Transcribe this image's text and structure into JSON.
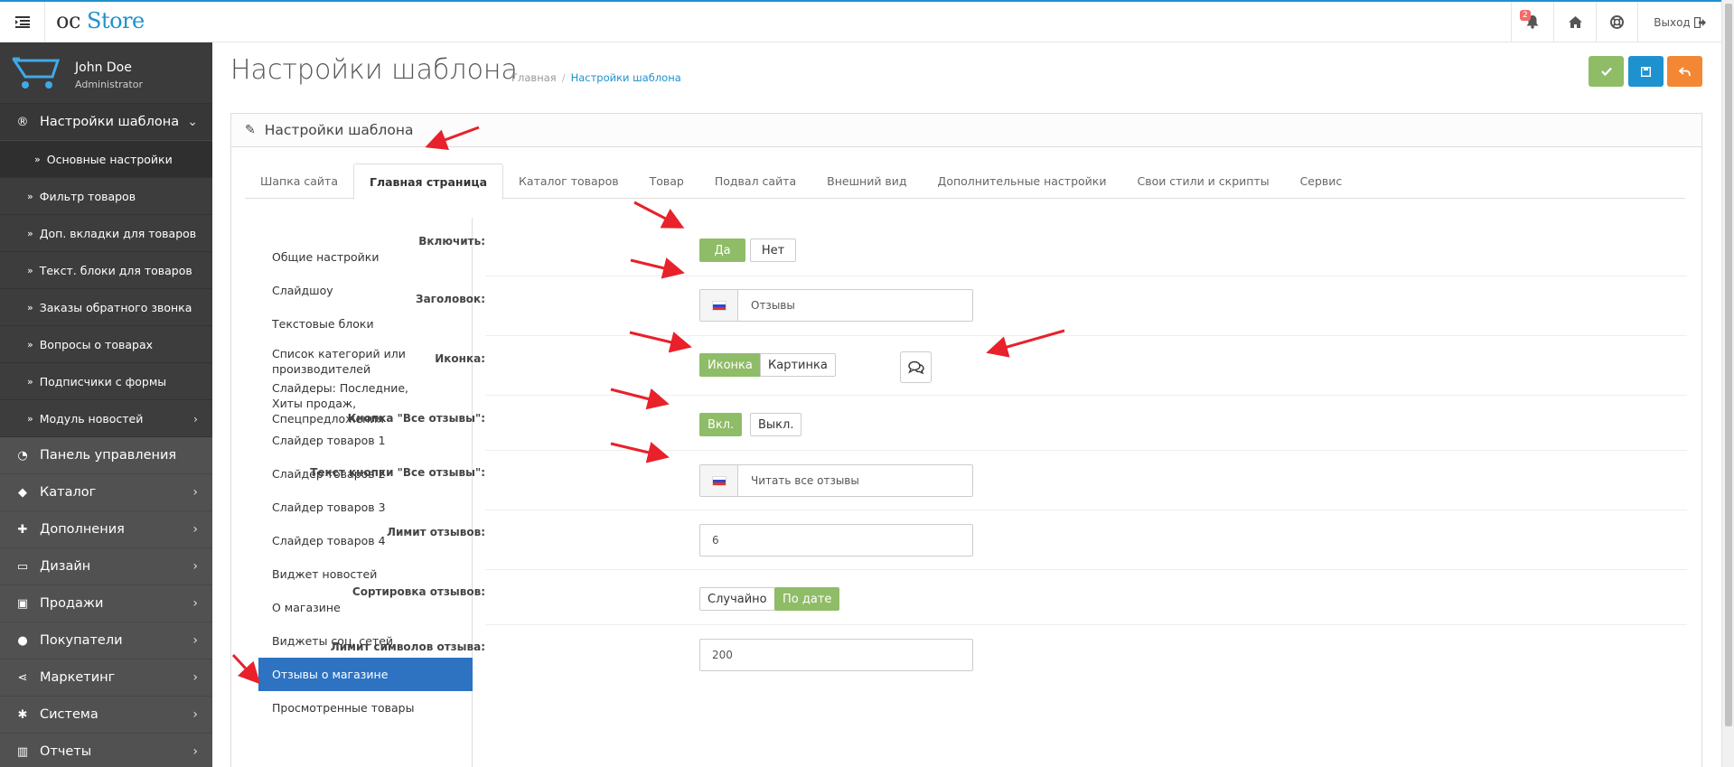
{
  "header": {
    "logo_oc": "oc",
    "logo_store": "Store",
    "notification_count": "2",
    "logout_label": "Выход"
  },
  "sidebar": {
    "user_name": "John Doe",
    "user_role": "Administrator",
    "active_section": "Настройки шаблона",
    "sub_items": [
      "Основные настройки",
      "Фильтр товаров",
      "Доп. вкладки для товаров",
      "Текст. блоки для товаров",
      "Заказы обратного звонка",
      "Вопросы о товарах",
      "Подписчики с формы",
      "Модуль новостей"
    ],
    "menu": [
      "Панель управления",
      "Каталог",
      "Дополнения",
      "Дизайн",
      "Продажи",
      "Покупатели",
      "Маркетинг",
      "Система",
      "Отчеты"
    ]
  },
  "page": {
    "title": "Настройки шаблона",
    "breadcrumb_home": "Главная",
    "breadcrumb_current": "Настройки шаблона",
    "panel_title": "Настройки шаблона"
  },
  "tabs": [
    "Шапка сайта",
    "Главная страница",
    "Каталог товаров",
    "Товар",
    "Подвал сайта",
    "Внешний вид",
    "Дополнительные настройки",
    "Свои стили и скрипты",
    "Сервис"
  ],
  "subnav": [
    "Общие настройки",
    "Слайдшоу",
    "Текстовые блоки",
    "Список категорий или производителей",
    "Слайдеры: Последние, Хиты продаж, Спецпредложения",
    "Слайдер товаров 1",
    "Слайдер товаров 2",
    "Слайдер товаров 3",
    "Слайдер товаров 4",
    "Виджет новостей",
    "О магазине",
    "Виджеты соц. сетей",
    "Отзывы о магазине",
    "Просмотренные товары"
  ],
  "form": {
    "enable_label": "Включить:",
    "enable_yes": "Да",
    "enable_no": "Нет",
    "heading_label": "Заголовок:",
    "heading_value": "Отзывы",
    "icon_label": "Иконка:",
    "icon_opt1": "Иконка",
    "icon_opt2": "Картинка",
    "all_btn_label": "Кнопка \"Все отзывы\":",
    "all_btn_on": "Вкл.",
    "all_btn_off": "Выкл.",
    "all_btn_text_label": "Текст кнопки \"Все отзывы\":",
    "all_btn_text_value": "Читать все отзывы",
    "limit_label": "Лимит отзывов:",
    "limit_value": "6",
    "sort_label": "Сортировка отзывов:",
    "sort_random": "Случайно",
    "sort_date": "По дате",
    "char_limit_label": "Лимит символов отзыва:",
    "char_limit_value": "200"
  },
  "colors": {
    "brand": "#1e91cf",
    "sidebar": "#515151",
    "toggle_on": "#8fbc67",
    "btn_green": "#8fbc67",
    "btn_blue": "#1e91cf",
    "btn_orange": "#f38733",
    "subnav_active": "#2d73c2",
    "annotation_arrow": "#e8212a"
  }
}
